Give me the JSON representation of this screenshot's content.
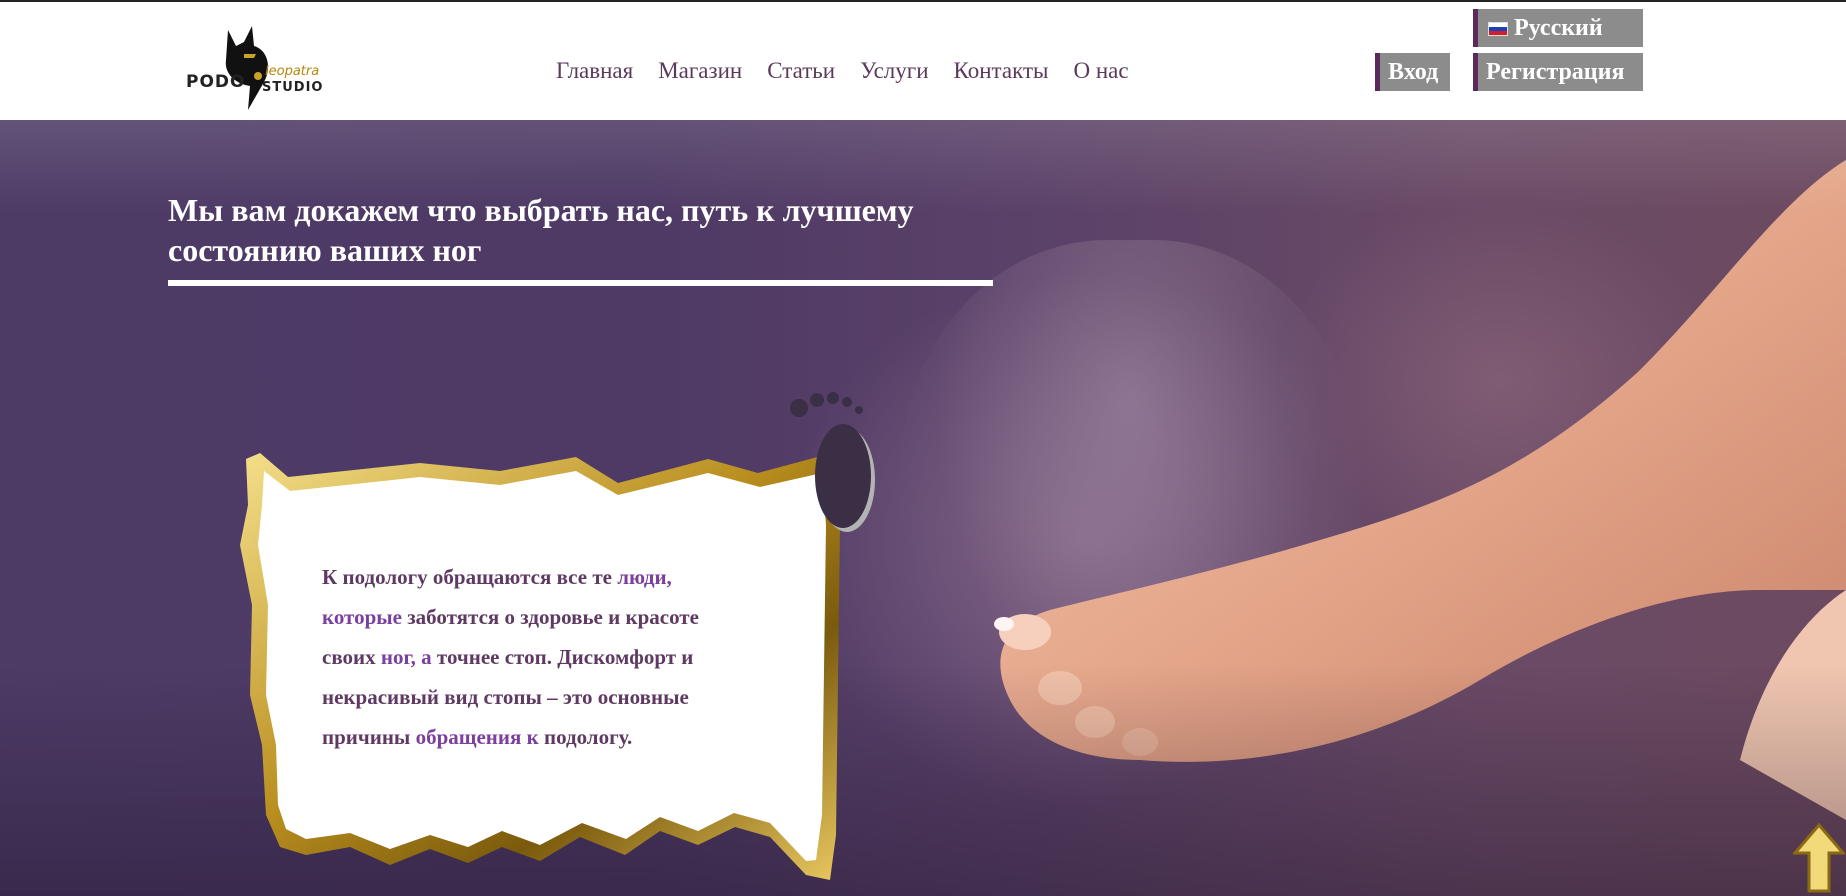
{
  "header": {
    "logo": {
      "alt_text_podo": "PODO",
      "alt_text_cleopatra": "leopatra",
      "alt_text_studio": "STUDIO"
    },
    "nav": [
      {
        "label": "Главная"
      },
      {
        "label": "Магазин"
      },
      {
        "label": "Статьи"
      },
      {
        "label": "Услуги"
      },
      {
        "label": "Контакты"
      },
      {
        "label": "О нас"
      }
    ],
    "language_label": "Русский",
    "login_label": "Вход",
    "register_label": "Регистрация"
  },
  "hero": {
    "heading": "Мы вам докажем что выбрать нас, путь к лучшему состоянию ваших ног",
    "card_text_part1": "К подологу обращаются все те ",
    "card_text_hl1": "люди, которые",
    "card_text_part2": " заботятся о здоровье и красоте своих ",
    "card_text_hl2": "ног, а",
    "card_text_part3": " точнее стоп. Дискомфорт и некрасивый вид стопы – это основные причины ",
    "card_text_hl3": "обращения к",
    "card_text_part4": " подологу."
  },
  "colors": {
    "accent_purple": "#5a2a5a",
    "button_gray": "#8c8c8c",
    "gold": "#c9a227",
    "hero_purple": "#4e3a65"
  },
  "icons": {
    "flag": "russia-flag-icon",
    "footprint": "footprint-icon",
    "scroll_top": "arrow-up-icon"
  }
}
